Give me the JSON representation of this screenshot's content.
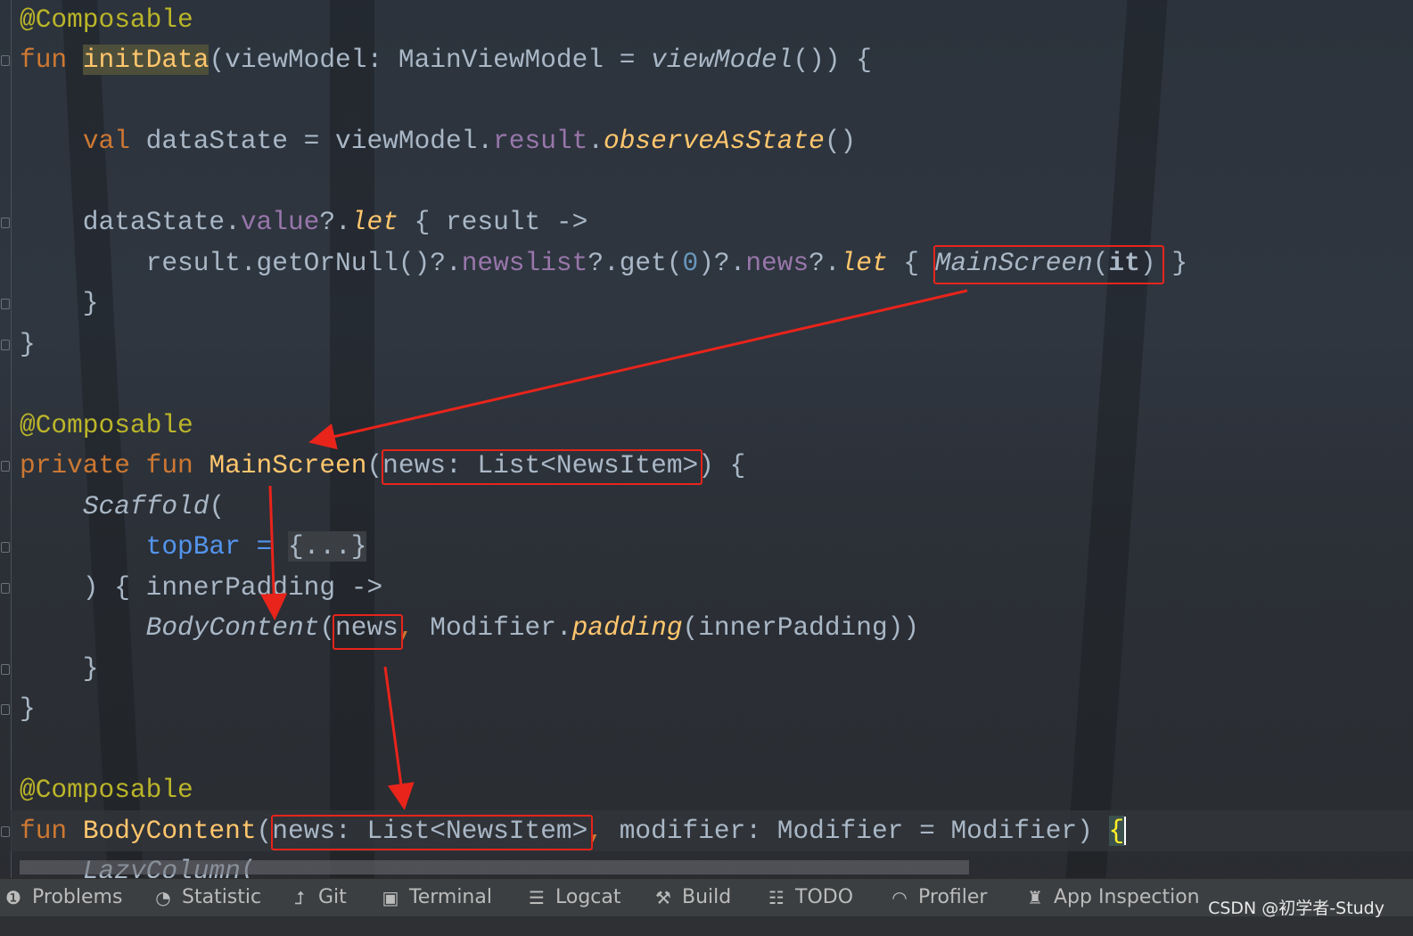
{
  "editor": {
    "lines": [
      {
        "row": 0,
        "tokens": [
          [
            "@Composable",
            "an"
          ]
        ]
      },
      {
        "row": 1,
        "tokens": [
          [
            "fun ",
            "kw"
          ],
          [
            "initData",
            "fn hl"
          ],
          [
            "(viewModel: MainViewModel = ",
            ""
          ],
          [
            "viewModel",
            "iv"
          ],
          [
            "()) {",
            ""
          ]
        ]
      },
      {
        "row": 3,
        "tokens": [
          [
            "    ",
            ""
          ],
          [
            "val ",
            "kw"
          ],
          [
            "dataState = viewModel.",
            ""
          ],
          [
            "result",
            "pr"
          ],
          [
            ".",
            ""
          ],
          [
            "observeAsState",
            "it"
          ],
          [
            "()",
            ""
          ]
        ]
      },
      {
        "row": 5,
        "tokens": [
          [
            "    dataState.",
            ""
          ],
          [
            "value",
            "pr"
          ],
          [
            "?.",
            ""
          ],
          [
            "let",
            "it"
          ],
          [
            " { result ->",
            ""
          ]
        ]
      },
      {
        "row": 6,
        "tokens": [
          [
            "        result.getOrNull()?.",
            ""
          ],
          [
            "newslist",
            "pr"
          ],
          [
            "?.get(",
            ""
          ],
          [
            "0",
            "num"
          ],
          [
            ")?.",
            ""
          ],
          [
            "news",
            "pr"
          ],
          [
            "?.",
            ""
          ],
          [
            "let",
            "it"
          ],
          [
            " { ",
            ""
          ],
          [
            "MainScreen",
            "iv"
          ],
          [
            "(",
            ""
          ],
          [
            "it",
            "kw-it"
          ],
          [
            ") }",
            ""
          ]
        ]
      },
      {
        "row": 7,
        "tokens": [
          [
            "    }",
            ""
          ]
        ]
      },
      {
        "row": 8,
        "tokens": [
          [
            "}",
            ""
          ]
        ]
      },
      {
        "row": 10,
        "tokens": [
          [
            "@Composable",
            "an"
          ]
        ]
      },
      {
        "row": 11,
        "tokens": [
          [
            "private fun ",
            "kw"
          ],
          [
            "MainScreen",
            "fn"
          ],
          [
            "(news: List<NewsItem>) {",
            ""
          ]
        ]
      },
      {
        "row": 12,
        "tokens": [
          [
            "    ",
            ""
          ],
          [
            "Scaffold",
            "iv"
          ],
          [
            "(",
            ""
          ]
        ]
      },
      {
        "row": 13,
        "tokens": [
          [
            "        ",
            ""
          ],
          [
            "topBar",
            "na"
          ],
          [
            " = ",
            "na"
          ],
          [
            "{...}",
            "fold-t"
          ]
        ]
      },
      {
        "row": 14,
        "tokens": [
          [
            "    ) { innerPadding ->",
            ""
          ]
        ]
      },
      {
        "row": 15,
        "tokens": [
          [
            "        ",
            ""
          ],
          [
            "BodyContent",
            "iv"
          ],
          [
            "(news",
            ""
          ],
          [
            ", ",
            "kw"
          ],
          [
            "Modifier.",
            ""
          ],
          [
            "padding",
            "it"
          ],
          [
            "(innerPadding))",
            ""
          ]
        ]
      },
      {
        "row": 16,
        "tokens": [
          [
            "    }",
            ""
          ]
        ]
      },
      {
        "row": 17,
        "tokens": [
          [
            "}",
            ""
          ]
        ]
      },
      {
        "row": 19,
        "tokens": [
          [
            "@Composable",
            "an"
          ]
        ]
      },
      {
        "row": 20,
        "tokens": [
          [
            "fun ",
            "kw"
          ],
          [
            "BodyContent",
            "fn"
          ],
          [
            "(news: List<NewsItem>",
            ""
          ],
          [
            ", ",
            "kw"
          ],
          [
            "modifier: Modifier = Modifier) ",
            ""
          ],
          [
            "{",
            "brace"
          ]
        ]
      },
      {
        "row": 21,
        "tokens": [
          [
            "    ",
            ""
          ],
          [
            "LazyColumn",
            "iv"
          ],
          [
            "(",
            ""
          ]
        ]
      }
    ]
  },
  "annotation_color": "#e8241b",
  "toolbar": {
    "items": [
      {
        "icon": "problems-icon",
        "glyph": "❶",
        "label": "Problems"
      },
      {
        "icon": "statistic-icon",
        "glyph": "◔",
        "label": "Statistic"
      },
      {
        "icon": "git-icon",
        "glyph": "⮥",
        "label": "Git"
      },
      {
        "icon": "terminal-icon",
        "glyph": "▣",
        "label": "Terminal"
      },
      {
        "icon": "logcat-icon",
        "glyph": "☰",
        "label": "Logcat"
      },
      {
        "icon": "build-icon",
        "glyph": "⚒",
        "label": "Build"
      },
      {
        "icon": "todo-icon",
        "glyph": "☷",
        "label": "TODO"
      },
      {
        "icon": "profiler-icon",
        "glyph": "◠",
        "label": "Profiler"
      },
      {
        "icon": "app-inspection-icon",
        "glyph": "♜",
        "label": "App Inspection"
      }
    ]
  },
  "watermark": "CSDN @初学者-Study"
}
